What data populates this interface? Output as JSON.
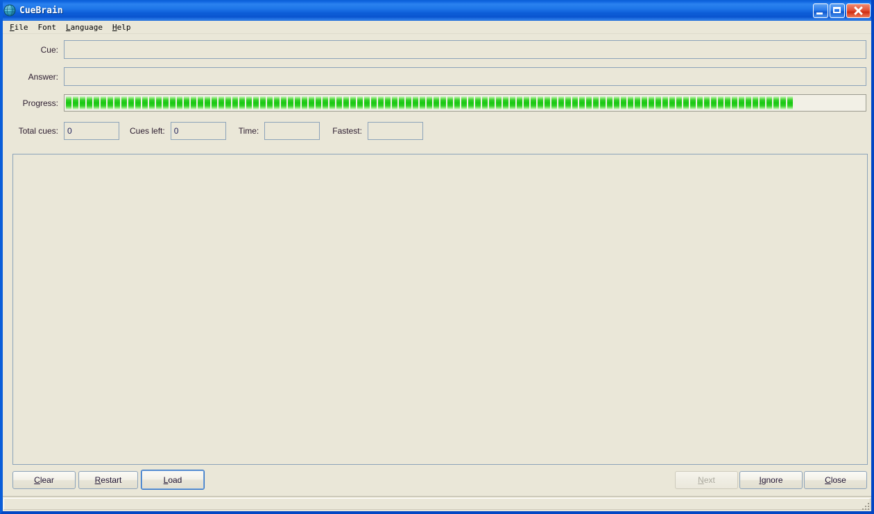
{
  "window": {
    "title": "CueBrain",
    "icon": "globe-icon",
    "controls": {
      "minimize": "Minimize",
      "maximize": "Maximize",
      "close": "Close"
    }
  },
  "menubar": {
    "items": [
      {
        "label": "File",
        "mnemonic": "F",
        "rest": "ile"
      },
      {
        "label": "Font",
        "mnemonic": "F",
        "rest": "ont"
      },
      {
        "label": "Language",
        "mnemonic": "L",
        "rest": "anguage"
      },
      {
        "label": "Help",
        "mnemonic": "H",
        "rest": "elp"
      }
    ]
  },
  "form": {
    "cue": {
      "label": "Cue:",
      "value": "",
      "placeholder": ""
    },
    "answer": {
      "label": "Answer:",
      "value": "",
      "placeholder": ""
    },
    "progress": {
      "label": "Progress:",
      "percent": 100,
      "segments": 105,
      "color": "#18c711"
    }
  },
  "stats": {
    "total_cues": {
      "label": "Total cues:",
      "value": "0"
    },
    "cues_left": {
      "label": "Cues left:",
      "value": "0"
    },
    "time": {
      "label": "Time:",
      "value": ""
    },
    "fastest": {
      "label": "Fastest:",
      "value": ""
    }
  },
  "content": {
    "text": ""
  },
  "buttons": {
    "left": [
      {
        "name": "clear",
        "label": "Clear",
        "mnemonic": "C",
        "pre": "",
        "rest": "lear",
        "disabled": false,
        "default": false
      },
      {
        "name": "restart",
        "label": "Restart",
        "mnemonic": "R",
        "pre": "",
        "rest": "estart",
        "disabled": false,
        "default": false
      },
      {
        "name": "load",
        "label": "Load",
        "mnemonic": "L",
        "pre": "",
        "rest": "oad",
        "disabled": false,
        "default": true
      }
    ],
    "right": [
      {
        "name": "next",
        "label": "Next",
        "mnemonic": "N",
        "pre": "",
        "rest": "ext",
        "disabled": true,
        "default": false
      },
      {
        "name": "ignore",
        "label": "Ignore",
        "mnemonic": "I",
        "pre": "",
        "rest": "gnore",
        "disabled": false,
        "default": false
      },
      {
        "name": "close",
        "label": "Close",
        "mnemonic": "C",
        "pre": "",
        "rest": "lose",
        "disabled": false,
        "default": false
      }
    ]
  },
  "statusbar": {
    "text": "",
    "grip": "resize-grip"
  },
  "colors": {
    "window_bg": "#eae7d8",
    "title_blue": "#0b5fd5",
    "field_border": "#8ba2b9",
    "progress_green": "#18c711",
    "text": "#2b1b2e"
  }
}
